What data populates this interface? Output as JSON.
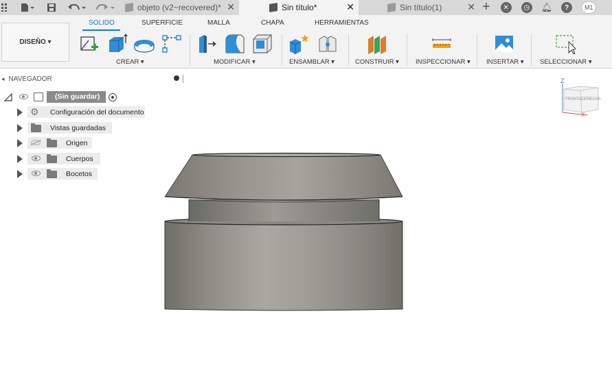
{
  "topbar": {
    "tabs": [
      {
        "label": "objeto (v2~recovered)*",
        "active": false
      },
      {
        "label": "Sin título*",
        "active": true
      },
      {
        "label": "Sin título(1)",
        "active": false
      }
    ],
    "avatar": "M1"
  },
  "ribbon": {
    "workspace": "DISEÑO ▾",
    "tabs": [
      "SOLIDO",
      "SUPERFICIE",
      "MALLA",
      "CHAPA",
      "HERRAMIENTAS"
    ],
    "active_tab": "SOLIDO",
    "groups": [
      "CREAR ▾",
      "MODIFICAR ▾",
      "ENSAMBLAR ▾",
      "CONSTRUIR ▾",
      "INSPECCIONAR ▾",
      "INSERTAR ▾",
      "SELECCIONAR ▾"
    ],
    "accent_color": "#0a7dd6"
  },
  "navigator": {
    "title": "NAVEGADOR",
    "root": "(Sin guardar)",
    "items": [
      {
        "label": "Configuración del documento",
        "icon": "gear-icon"
      },
      {
        "label": "Vistas guardadas",
        "icon": "folder-icon"
      },
      {
        "label": "Origen",
        "icon": "folder-icon",
        "hidden": true
      },
      {
        "label": "Cuerpos",
        "icon": "folder-icon"
      },
      {
        "label": "Bocetos",
        "icon": "folder-icon"
      }
    ]
  },
  "viewcube": {
    "face_front": "FRONTAL",
    "face_right": "DERECHA",
    "axis_z": "Z",
    "axis_x": "X"
  }
}
